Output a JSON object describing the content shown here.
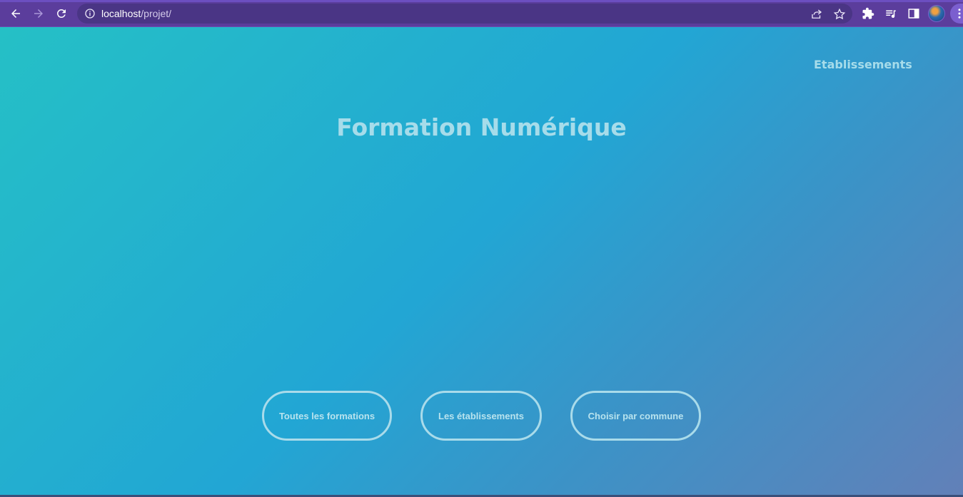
{
  "browser": {
    "url_host": "localhost",
    "url_path": "/projet/",
    "icons": {
      "back": "arrow-left-icon",
      "forward": "arrow-right-icon",
      "reload": "reload-icon",
      "site_info": "info-icon",
      "share": "share-icon",
      "bookmark": "star-icon",
      "extensions": "puzzle-icon",
      "media": "playlist-icon",
      "side_panel": "side-panel-icon",
      "profile": "avatar",
      "menu": "kebab-menu-icon"
    }
  },
  "page": {
    "nav_link": "Etablissements",
    "title": "Formation Numérique",
    "buttons": [
      {
        "label": "Toutes les formations"
      },
      {
        "label": "Les établissements"
      },
      {
        "label": "Choisir par commune"
      }
    ],
    "colors": {
      "gradient_start": "#25c0c6",
      "gradient_mid": "#22a6d4",
      "gradient_end": "#6280b8",
      "text": "#a6dcea",
      "chrome": "#5b3d9c"
    }
  }
}
